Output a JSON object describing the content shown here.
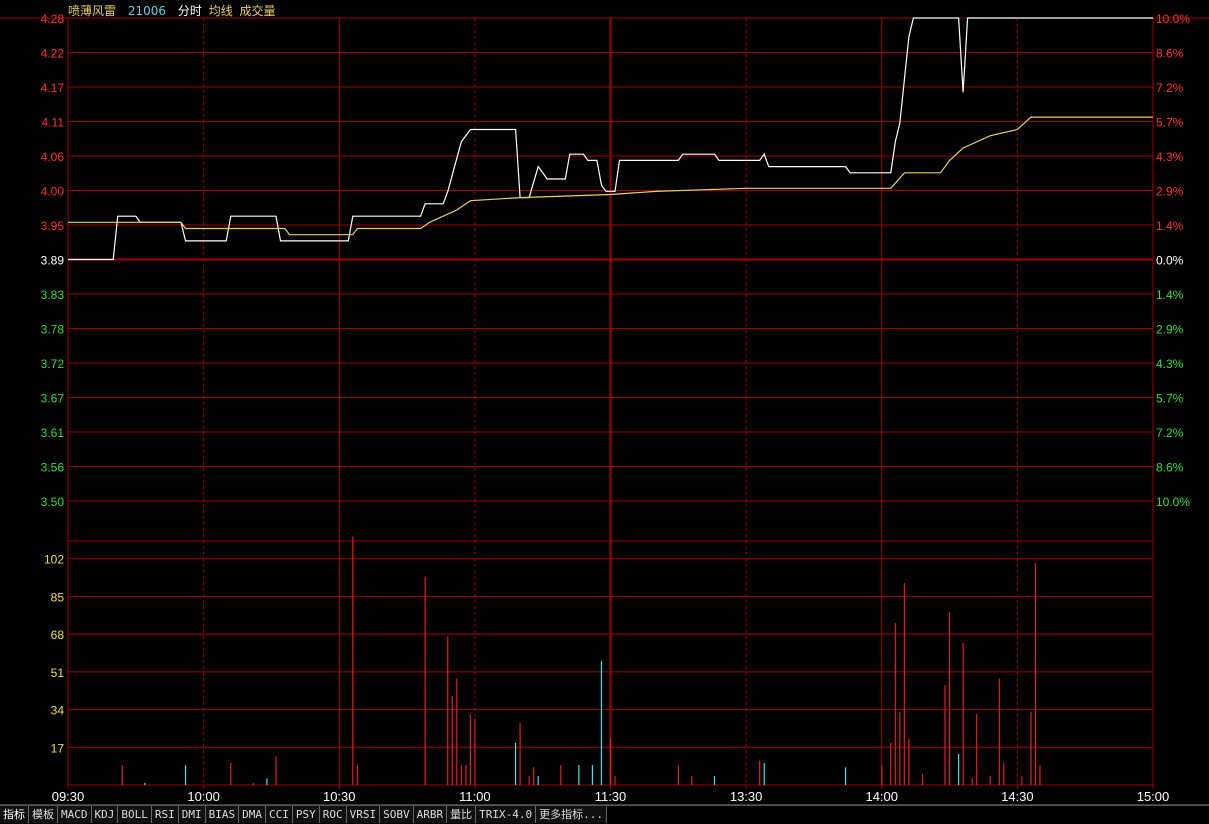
{
  "header": {
    "stock_name": "喷薄风雷",
    "stock_code": "21006",
    "labels": [
      "分时",
      "均线",
      "成交量"
    ]
  },
  "colors": {
    "grid": "#a00000",
    "up_text": "#ff3030",
    "down_text": "#30e030",
    "neutral_text": "#ffffff",
    "price_line": "#ffffff",
    "avg_line": "#e8d060",
    "vol_up": "#e02020",
    "vol_down": "#40e0f0",
    "volume_axis": "#f0e040"
  },
  "tabs": [
    "指标",
    "模板",
    "MACD",
    "KDJ",
    "BOLL",
    "RSI",
    "DMI",
    "BIAS",
    "DMA",
    "CCI",
    "PSY",
    "ROC",
    "VRSI",
    "SOBV",
    "ARBR",
    "量比",
    "TRIX-4.0",
    "更多指标..."
  ],
  "chart_data": [
    {
      "type": "line",
      "name": "intraday-price",
      "ylim": [
        3.5,
        4.28
      ],
      "base_price": 3.89,
      "price_ticks": [
        "4.28",
        "4.22",
        "4.17",
        "4.11",
        "4.06",
        "4.00",
        "3.95",
        "3.89",
        "3.83",
        "3.78",
        "3.72",
        "3.67",
        "3.61",
        "3.56",
        "3.50"
      ],
      "percent_ticks": [
        "10.0%",
        "8.6%",
        "7.2%",
        "5.7%",
        "4.3%",
        "2.9%",
        "1.4%",
        "0.0%",
        "1.4%",
        "2.9%",
        "4.3%",
        "5.7%",
        "7.2%",
        "8.6%",
        "10.0%"
      ],
      "x_time_labels": [
        "09:30",
        "10:00",
        "10:30",
        "11:00",
        "11:30",
        "13:30",
        "14:00",
        "14:30",
        "15:00"
      ],
      "x_minutes": [
        0,
        30,
        60,
        90,
        120,
        150,
        180,
        210,
        240
      ],
      "series": [
        {
          "points": [
            [
              0,
              3.89
            ],
            [
              10,
              3.89
            ],
            [
              11,
              3.96
            ],
            [
              15,
              3.96
            ],
            [
              16,
              3.95
            ],
            [
              25,
              3.95
            ],
            [
              26,
              3.92
            ],
            [
              35,
              3.92
            ],
            [
              36,
              3.96
            ],
            [
              46,
              3.96
            ],
            [
              47,
              3.92
            ],
            [
              62,
              3.92
            ],
            [
              63,
              3.96
            ],
            [
              78,
              3.96
            ],
            [
              79,
              3.98
            ],
            [
              83,
              3.98
            ],
            [
              84,
              4.0
            ],
            [
              87,
              4.08
            ],
            [
              89,
              4.1
            ],
            [
              99,
              4.1
            ],
            [
              100,
              3.99
            ],
            [
              102,
              3.99
            ],
            [
              104,
              4.04
            ],
            [
              106,
              4.02
            ],
            [
              110,
              4.02
            ],
            [
              111,
              4.06
            ],
            [
              114,
              4.06
            ],
            [
              115,
              4.05
            ],
            [
              117,
              4.05
            ],
            [
              118,
              4.01
            ],
            [
              119,
              4.0
            ],
            [
              121,
              4.0
            ],
            [
              122,
              4.05
            ],
            [
              135,
              4.05
            ],
            [
              136,
              4.06
            ],
            [
              143,
              4.06
            ],
            [
              144,
              4.05
            ],
            [
              153,
              4.05
            ],
            [
              154,
              4.06
            ],
            [
              155,
              4.04
            ],
            [
              172,
              4.04
            ],
            [
              173,
              4.03
            ],
            [
              182,
              4.03
            ],
            [
              183,
              4.08
            ],
            [
              184,
              4.11
            ],
            [
              186,
              4.25
            ],
            [
              187,
              4.28
            ],
            [
              197,
              4.28
            ],
            [
              198,
              4.16
            ],
            [
              199,
              4.28
            ],
            [
              240,
              4.28
            ]
          ]
        },
        {
          "points": [
            [
              0,
              3.95
            ],
            [
              25,
              3.95
            ],
            [
              26,
              3.94
            ],
            [
              48,
              3.94
            ],
            [
              49,
              3.93
            ],
            [
              63,
              3.93
            ],
            [
              64,
              3.94
            ],
            [
              78,
              3.94
            ],
            [
              80,
              3.95
            ],
            [
              86,
              3.97
            ],
            [
              89,
              3.985
            ],
            [
              100,
              3.99
            ],
            [
              120,
              3.995
            ],
            [
              130,
              4.0
            ],
            [
              150,
              4.005
            ],
            [
              182,
              4.005
            ],
            [
              185,
              4.03
            ],
            [
              193,
              4.03
            ],
            [
              195,
              4.05
            ],
            [
              198,
              4.07
            ],
            [
              204,
              4.09
            ],
            [
              210,
              4.1
            ],
            [
              213,
              4.12
            ],
            [
              240,
              4.12
            ]
          ]
        }
      ]
    },
    {
      "type": "bar",
      "name": "volume",
      "ylim": [
        0,
        110
      ],
      "y_ticks": [
        "102",
        "85",
        "68",
        "51",
        "34",
        "17"
      ],
      "bars": [
        [
          12,
          9,
          "up"
        ],
        [
          17,
          1,
          "down"
        ],
        [
          26,
          9,
          "down"
        ],
        [
          36,
          10,
          "up"
        ],
        [
          41,
          1,
          "up"
        ],
        [
          44,
          3,
          "down"
        ],
        [
          46,
          13,
          "up"
        ],
        [
          63,
          112,
          "up"
        ],
        [
          64,
          9,
          "up"
        ],
        [
          79,
          94,
          "up"
        ],
        [
          84,
          67,
          "up"
        ],
        [
          85,
          40,
          "up"
        ],
        [
          86,
          48,
          "up"
        ],
        [
          87,
          9,
          "up"
        ],
        [
          88,
          9,
          "up"
        ],
        [
          89,
          32,
          "up"
        ],
        [
          90,
          30,
          "up"
        ],
        [
          99,
          19,
          "down"
        ],
        [
          100,
          28,
          "up"
        ],
        [
          102,
          4,
          "up"
        ],
        [
          103,
          8,
          "up"
        ],
        [
          104,
          4,
          "down"
        ],
        [
          109,
          9,
          "up"
        ],
        [
          113,
          9,
          "down"
        ],
        [
          116,
          9,
          "down"
        ],
        [
          118,
          56,
          "down"
        ],
        [
          120,
          21,
          "up"
        ],
        [
          121,
          4,
          "up"
        ],
        [
          135,
          9,
          "up"
        ],
        [
          138,
          4,
          "up"
        ],
        [
          143,
          4,
          "down"
        ],
        [
          153,
          11,
          "up"
        ],
        [
          154,
          10,
          "down"
        ],
        [
          172,
          8,
          "down"
        ],
        [
          180,
          9,
          "up"
        ],
        [
          182,
          19,
          "up"
        ],
        [
          183,
          73,
          "up"
        ],
        [
          184,
          33,
          "up"
        ],
        [
          185,
          91,
          "up"
        ],
        [
          186,
          21,
          "up"
        ],
        [
          189,
          5,
          "up"
        ],
        [
          194,
          45,
          "up"
        ],
        [
          195,
          78,
          "up"
        ],
        [
          197,
          14,
          "down"
        ],
        [
          198,
          64,
          "up"
        ],
        [
          200,
          3,
          "up"
        ],
        [
          201,
          32,
          "up"
        ],
        [
          204,
          4,
          "up"
        ],
        [
          206,
          48,
          "up"
        ],
        [
          207,
          10,
          "up"
        ],
        [
          211,
          4,
          "up"
        ],
        [
          213,
          33,
          "up"
        ],
        [
          214,
          100,
          "up"
        ],
        [
          215,
          9,
          "up"
        ]
      ]
    }
  ]
}
